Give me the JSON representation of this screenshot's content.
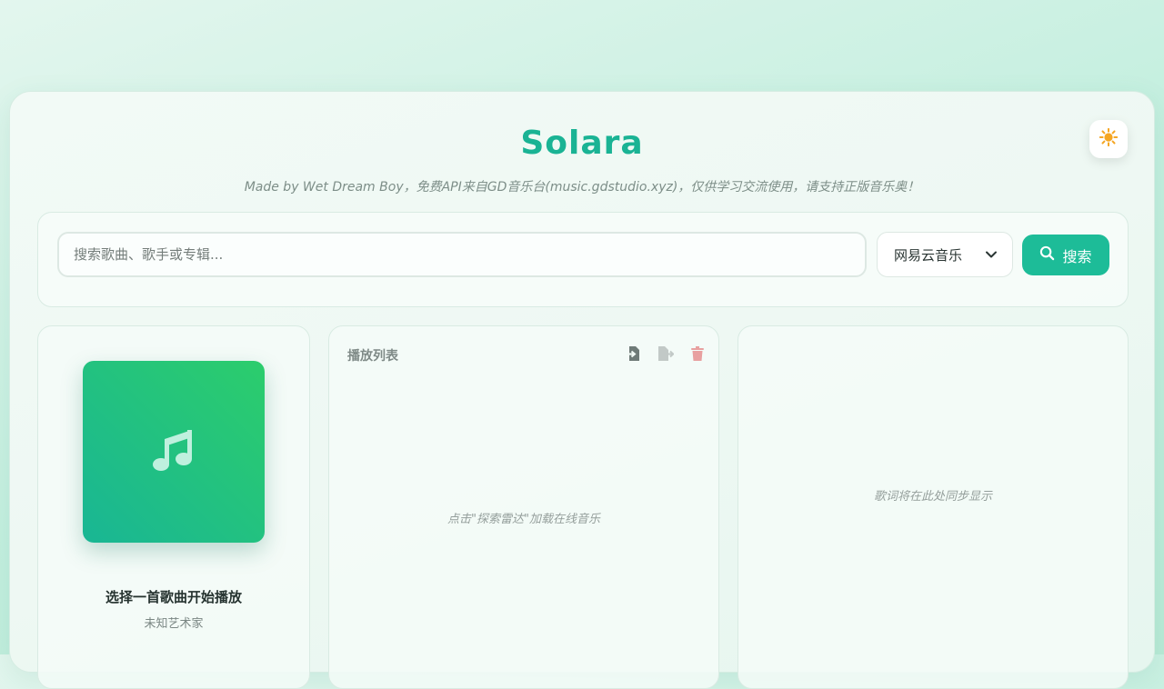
{
  "header": {
    "title": "Solara",
    "subtitle": "Made by Wet Dream Boy，免费API来自GD音乐台(music.gdstudio.xyz)，仅供学习交流使用，请支持正版音乐奥！"
  },
  "theme_toggle": {
    "icon": "sun-icon",
    "icon_color": "#f5a623"
  },
  "search": {
    "placeholder": "搜索歌曲、歌手或专辑...",
    "value": "",
    "source_selected": "网易云音乐",
    "button_label": "搜索"
  },
  "now_playing": {
    "title": "选择一首歌曲开始播放",
    "artist": "未知艺术家",
    "cover_icon": "music-note-icon"
  },
  "playlist": {
    "title": "播放列表",
    "actions": [
      "import-icon",
      "export-icon",
      "trash-icon"
    ],
    "empty_text": "点击\"探索雷达\"加载在线音乐"
  },
  "lyrics": {
    "empty_text": "歌词将在此处同步显示"
  },
  "colors": {
    "accent": "#1ab394",
    "button": "#1dbc98",
    "danger": "#e8a0a0"
  }
}
